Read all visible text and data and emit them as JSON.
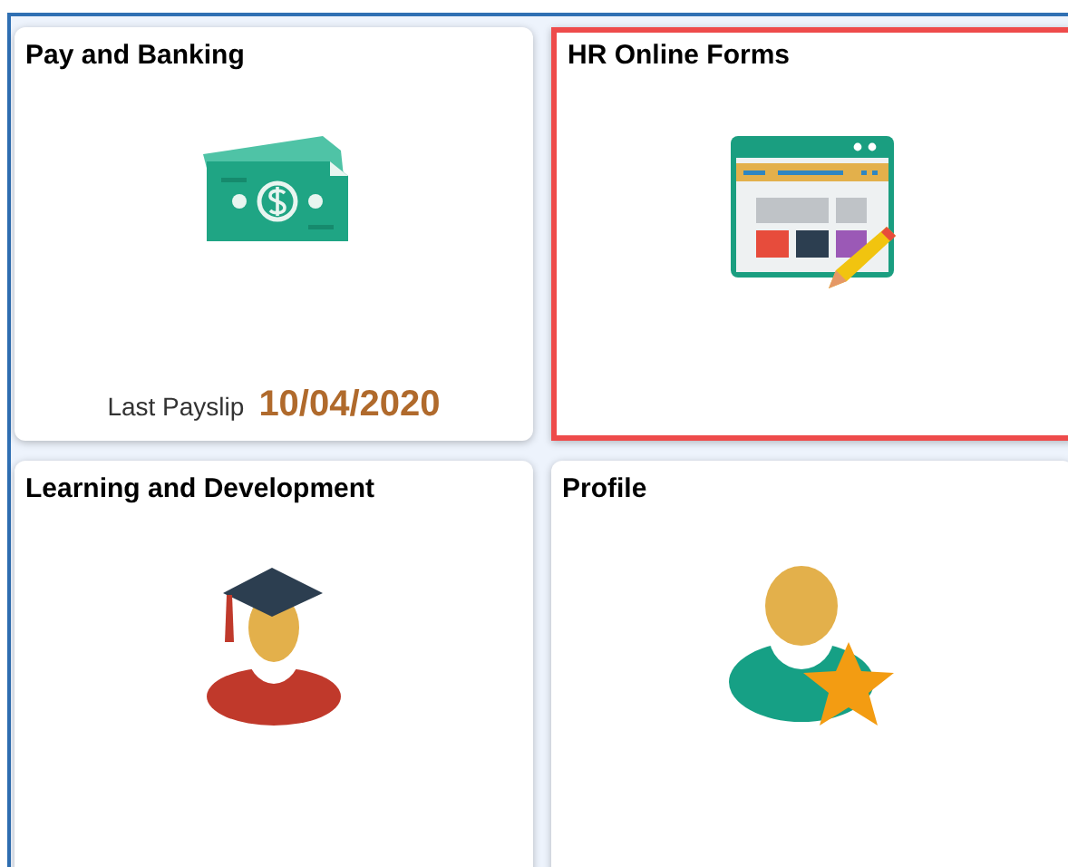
{
  "tiles": [
    {
      "title": "Pay and Banking",
      "kind": "money",
      "highlighted": false,
      "footer": {
        "label": "Last Payslip",
        "value": "10/04/2020"
      }
    },
    {
      "title": "HR Online Forms",
      "kind": "forms",
      "highlighted": true
    },
    {
      "title": "Learning and Development",
      "kind": "graduate",
      "highlighted": false
    },
    {
      "title": "Profile",
      "kind": "profile",
      "highlighted": false
    }
  ]
}
